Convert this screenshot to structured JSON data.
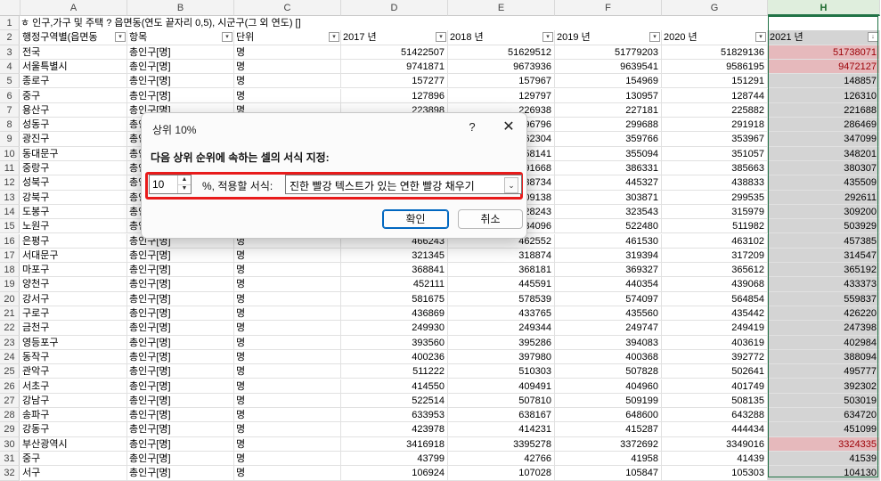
{
  "sheet": {
    "columns": [
      "A",
      "B",
      "C",
      "D",
      "E",
      "F",
      "G",
      "H"
    ],
    "title_row": "ㅎ 인구,가구 및 주택 ? 읍면동(연도 끝자리 0,5), 시군구(그 외 연도) []",
    "headers": [
      "행정구역별(읍면동",
      "항목",
      "단위",
      "2017 년",
      "2018 년",
      "2019 년",
      "2020 년",
      "2021 년"
    ],
    "rows": [
      [
        "전국",
        "총인구[명]",
        "명",
        "51422507",
        "51629512",
        "51779203",
        "51829136",
        "51738071"
      ],
      [
        "서울특별시",
        "총인구[명]",
        "명",
        "9741871",
        "9673936",
        "9639541",
        "9586195",
        "9472127"
      ],
      [
        "종로구",
        "총인구[명]",
        "명",
        "157277",
        "157967",
        "154969",
        "151291",
        "148857"
      ],
      [
        "중구",
        "총인구[명]",
        "명",
        "127896",
        "129797",
        "130957",
        "128744",
        "126310"
      ],
      [
        "용산구",
        "총인구[명]",
        "명",
        "223898",
        "226938",
        "227181",
        "225882",
        "221688"
      ],
      [
        "성동구",
        "총인구[명]",
        "명",
        "",
        "296796",
        "299688",
        "291918",
        "286469"
      ],
      [
        "광진구",
        "총인구[명]",
        "명",
        "",
        "362304",
        "359766",
        "353967",
        "347099"
      ],
      [
        "동대문구",
        "총인구[명]",
        "명",
        "",
        "358141",
        "355094",
        "351057",
        "348201"
      ],
      [
        "중랑구",
        "총인구[명]",
        "명",
        "",
        "391668",
        "386331",
        "385663",
        "380307"
      ],
      [
        "성북구",
        "총인구[명]",
        "명",
        "",
        "438734",
        "445327",
        "438833",
        "435509"
      ],
      [
        "강북구",
        "총인구[명]",
        "명",
        "",
        "309138",
        "303871",
        "299535",
        "292611"
      ],
      [
        "도봉구",
        "총인구[명]",
        "명",
        "",
        "328243",
        "323543",
        "315979",
        "309200"
      ],
      [
        "노원구",
        "총인구[명]",
        "명",
        "",
        "534096",
        "522480",
        "511982",
        "503929"
      ],
      [
        "은평구",
        "총인구[명]",
        "명",
        "466243",
        "462552",
        "461530",
        "463102",
        "457385"
      ],
      [
        "서대문구",
        "총인구[명]",
        "명",
        "321345",
        "318874",
        "319394",
        "317209",
        "314547"
      ],
      [
        "마포구",
        "총인구[명]",
        "명",
        "368841",
        "368181",
        "369327",
        "365612",
        "365192"
      ],
      [
        "양천구",
        "총인구[명]",
        "명",
        "452111",
        "445591",
        "440354",
        "439068",
        "433373"
      ],
      [
        "강서구",
        "총인구[명]",
        "명",
        "581675",
        "578539",
        "574097",
        "564854",
        "559837"
      ],
      [
        "구로구",
        "총인구[명]",
        "명",
        "436869",
        "433765",
        "435560",
        "435442",
        "426220"
      ],
      [
        "금천구",
        "총인구[명]",
        "명",
        "249930",
        "249344",
        "249747",
        "249419",
        "247398"
      ],
      [
        "영등포구",
        "총인구[명]",
        "명",
        "393560",
        "395286",
        "394083",
        "403619",
        "402984"
      ],
      [
        "동작구",
        "총인구[명]",
        "명",
        "400236",
        "397980",
        "400368",
        "392772",
        "388094"
      ],
      [
        "관악구",
        "총인구[명]",
        "명",
        "511222",
        "510303",
        "507828",
        "502641",
        "495777"
      ],
      [
        "서초구",
        "총인구[명]",
        "명",
        "414550",
        "409491",
        "404960",
        "401749",
        "392302"
      ],
      [
        "강남구",
        "총인구[명]",
        "명",
        "522514",
        "507810",
        "509199",
        "508135",
        "503019"
      ],
      [
        "송파구",
        "총인구[명]",
        "명",
        "633953",
        "638167",
        "648600",
        "643288",
        "634720"
      ],
      [
        "강동구",
        "총인구[명]",
        "명",
        "423978",
        "414231",
        "415287",
        "444434",
        "451099"
      ],
      [
        "부산광역시",
        "총인구[명]",
        "명",
        "3416918",
        "3395278",
        "3372692",
        "3349016",
        "3324335"
      ],
      [
        "중구",
        "총인구[명]",
        "명",
        "43799",
        "42766",
        "41958",
        "41439",
        "41539"
      ],
      [
        "서구",
        "총인구[명]",
        "명",
        "106924",
        "107028",
        "105847",
        "105303",
        "104130"
      ]
    ],
    "highlighted_rows": [
      0,
      1,
      27
    ],
    "sorted_indicator": "↓"
  },
  "dialog": {
    "title": "상위 10%",
    "help": "?",
    "close": "✕",
    "prompt": "다음 상위 순위에 속하는 셀의 서식 지정:",
    "spin_value": "10",
    "apply_label": "%, 적용할 서식:",
    "format_value": "진한 빨강 텍스트가 있는 연한 빨강 채우기",
    "ok_label": "확인",
    "cancel_label": "취소"
  }
}
